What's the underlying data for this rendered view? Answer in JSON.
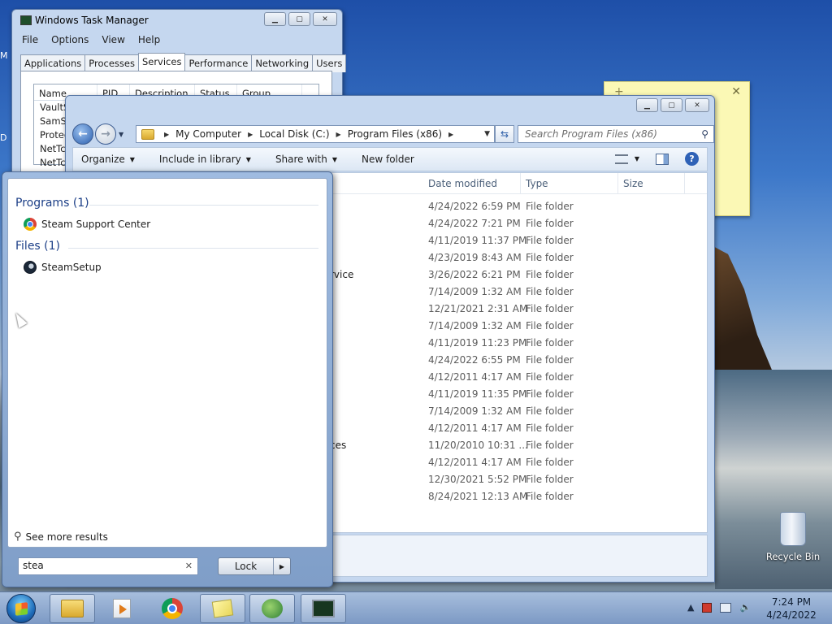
{
  "desktop": {
    "edge_glyphs": [
      "M",
      "D"
    ],
    "recycle_bin_label": "Recycle Bin"
  },
  "task_manager": {
    "title": "Windows Task Manager",
    "menu": [
      "File",
      "Options",
      "View",
      "Help"
    ],
    "tabs": [
      "Applications",
      "Processes",
      "Services",
      "Performance",
      "Networking",
      "Users"
    ],
    "active_tab": "Services",
    "columns": [
      "Name",
      "PID",
      "Description",
      "Status",
      "Group"
    ],
    "rows": [
      "VaultSv",
      "SamSs",
      "Protec",
      "NetTcp",
      "NetTcp"
    ]
  },
  "explorer": {
    "breadcrumb": [
      "My Computer",
      "Local Disk (C:)",
      "Program Files (x86)"
    ],
    "search_placeholder": "Search Program Files (x86)",
    "toolbar": {
      "organize": "Organize",
      "include": "Include in library",
      "share": "Share with",
      "new_folder": "New folder"
    },
    "columns": {
      "date": "Date modified",
      "type": "Type",
      "size": "Size"
    },
    "rows": [
      {
        "name": "",
        "date": "4/24/2022 6:59 PM",
        "type": "File folder"
      },
      {
        "name": "",
        "date": "4/24/2022 7:21 PM",
        "type": "File folder"
      },
      {
        "name": "",
        "date": "4/11/2019 11:37 PM",
        "type": "File folder"
      },
      {
        "name": "",
        "date": "4/23/2019 8:43 AM",
        "type": "File folder"
      },
      {
        "name": "rvice",
        "date": "3/26/2022 6:21 PM",
        "type": "File folder"
      },
      {
        "name": "",
        "date": "7/14/2009 1:32 AM",
        "type": "File folder"
      },
      {
        "name": "",
        "date": "12/21/2021 2:31 AM",
        "type": "File folder"
      },
      {
        "name": "",
        "date": "7/14/2009 1:32 AM",
        "type": "File folder"
      },
      {
        "name": "",
        "date": "4/11/2019 11:23 PM",
        "type": "File folder"
      },
      {
        "name": "",
        "date": "4/24/2022 6:55 PM",
        "type": "File folder"
      },
      {
        "name": "",
        "date": "4/12/2011 4:17 AM",
        "type": "File folder"
      },
      {
        "name": "",
        "date": "4/11/2019 11:35 PM",
        "type": "File folder"
      },
      {
        "name": "",
        "date": "7/14/2009 1:32 AM",
        "type": "File folder"
      },
      {
        "name": "",
        "date": "4/12/2011 4:17 AM",
        "type": "File folder"
      },
      {
        "name": "ces",
        "date": "11/20/2010 10:31 ...",
        "type": "File folder"
      },
      {
        "name": "",
        "date": "4/12/2011 4:17 AM",
        "type": "File folder"
      },
      {
        "name": "",
        "date": "12/30/2021 5:52 PM",
        "type": "File folder"
      },
      {
        "name": "",
        "date": "8/24/2021 12:13 AM",
        "type": "File folder"
      }
    ]
  },
  "start_menu": {
    "groups": [
      {
        "label": "Programs (1)",
        "items": [
          "Steam Support Center"
        ]
      },
      {
        "label": "Files (1)",
        "items": [
          "SteamSetup"
        ]
      }
    ],
    "see_more": "See more results",
    "search_value": "stea",
    "lock_label": "Lock"
  },
  "taskbar": {
    "time": "7:24 PM",
    "date": "4/24/2022"
  }
}
